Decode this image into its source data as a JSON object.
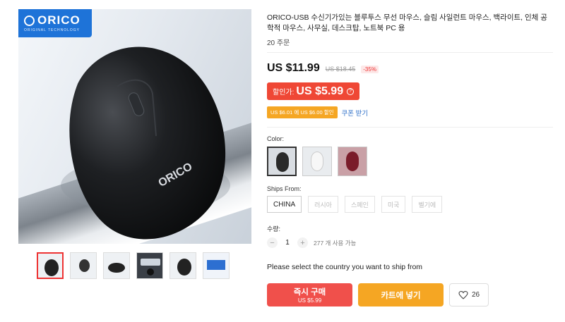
{
  "gallery": {
    "brand_logo": "ORICO",
    "brand_tagline": "ORIGINAL TECHNOLOGY",
    "mouse_brand_print": "ORICO",
    "thumbnail_count": 6,
    "active_thumbnail": 1
  },
  "product": {
    "title": "ORICO-USB 수신기가있는 블루투스 무선 마우스, 슬림 사일런트 마우스, 백라이트, 인체 공학적 마우스, 사무실, 데스크탑, 노트북 PC 용",
    "orders": "20 주문",
    "price": "US $11.99",
    "old_price": "US $18.45",
    "discount": "-35%",
    "sale_label": "할인가:",
    "sale_price": "US $5.99",
    "coupon_tag": "US $6.01 에 US $6.00 할인",
    "coupon_link": "쿠폰 받기"
  },
  "options": {
    "color_label": "Color:",
    "colors": [
      {
        "name": "black",
        "hex": "#2a2a2a"
      },
      {
        "name": "white",
        "hex": "#f2f2f2"
      },
      {
        "name": "red",
        "hex": "#7a1c2a"
      }
    ],
    "ships_from_label": "Ships From:",
    "ships_from": [
      "CHINA",
      "러시아",
      "스페인",
      "미국",
      "벨기에"
    ],
    "quantity_label": "수량:",
    "quantity_value": "1",
    "quantity_available": "277 개 사용 가능"
  },
  "notice": "Please select the country you want to ship from",
  "actions": {
    "buy_now": "즉시 구매",
    "buy_price": "US $5.99",
    "add_to_cart": "카트에 넣기",
    "wish_count": "26"
  },
  "colors": {
    "accent_red": "#ef4735",
    "accent_orange": "#f5a623",
    "link_blue": "#2f70c9",
    "brand_blue": "#1e73d8"
  }
}
